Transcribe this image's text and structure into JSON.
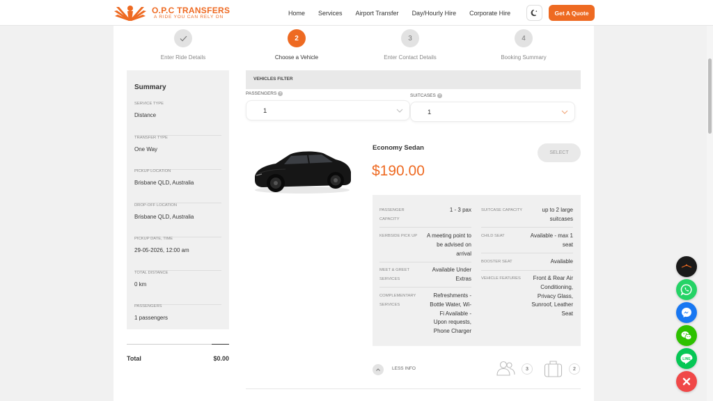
{
  "brand": {
    "name": "O.P.C TRANSFERS",
    "tagline": "A RIDE YOU CAN RELY ON",
    "accent_color": "#ee6a22"
  },
  "nav": {
    "items": [
      "Home",
      "Services",
      "Airport Transfer",
      "Day/Hourly Hire",
      "Corporate Hire"
    ],
    "theme_icon": "moon-icon",
    "cta_label": "Get A Quote"
  },
  "steps": [
    {
      "number": "",
      "icon": "check-icon",
      "label": "Enter Ride Details",
      "state": "done"
    },
    {
      "number": "2",
      "label": "Choose a Vehicle",
      "state": "active"
    },
    {
      "number": "3",
      "label": "Enter Contact Details",
      "state": "pending"
    },
    {
      "number": "4",
      "label": "Booking Summary",
      "state": "pending"
    }
  ],
  "summary": {
    "title": "Summary",
    "items": [
      {
        "key": "SERVICE TYPE",
        "value": "Distance"
      },
      {
        "key": "TRANSFER TYPE",
        "value": "One Way"
      },
      {
        "key": "PICKUP LOCATION",
        "value": "Brisbane QLD, Australia"
      },
      {
        "key": "DROP-OFF LOCATION",
        "value": "Brisbane QLD, Australia"
      },
      {
        "key": "PICKUP DATE, TIME",
        "value": "29-05-2026, 12:00 am"
      },
      {
        "key": "TOTAL DISTANCE",
        "value": "0 km"
      },
      {
        "key": "PASSENGERS",
        "value": "1 passengers"
      }
    ],
    "total_label": "Total",
    "total_value": "$0.00"
  },
  "filter": {
    "title": "VEHICLES FILTER",
    "passengers_label": "PASSENGERS",
    "passengers_value": "1",
    "suitcases_label": "SUITCASES",
    "suitcases_value": "1"
  },
  "vehicle": {
    "name": "Economy Sedan",
    "price": "$190.00",
    "select_label": "SELECT",
    "specs_left": [
      {
        "key_lines": [
          "PASSENGER",
          "CAPACITY"
        ],
        "value_lines": [
          "1 - 3 pax"
        ]
      },
      {
        "key_lines": [
          "KERBSIDE PICK UP"
        ],
        "value_lines": [
          "A meeting point to",
          "be advised on",
          "arrival"
        ]
      },
      {
        "key_lines": [
          "MEET & GREET",
          "SERVICES"
        ],
        "value_lines": [
          "Available Under",
          "Extras"
        ]
      },
      {
        "key_lines": [
          "COMPLEMENTARY",
          "SERVICES"
        ],
        "value_lines": [
          "Refreshments -",
          "Bottle Water, Wi-",
          "Fi Available -",
          "Upon requests,",
          "Phone Charger"
        ]
      }
    ],
    "specs_right": [
      {
        "key_lines": [
          "SUITCASE CAPACITY"
        ],
        "value_lines": [
          "up to 2 large",
          "suitcases"
        ]
      },
      {
        "key_lines": [
          "CHILD SEAT"
        ],
        "value_lines": [
          "Available - max 1",
          "seat"
        ]
      },
      {
        "key_lines": [
          "BOOSTER SEAT"
        ],
        "value_lines": [
          "Available"
        ]
      },
      {
        "key_lines": [
          "VEHICLE FEATURES"
        ],
        "value_lines": [
          "Front & Rear Air",
          "Conditioning,",
          "Privacy Glass,",
          "Sunroof, Leather",
          "Seat"
        ]
      }
    ],
    "less_info_label": "LESS INFO",
    "passenger_count": "3",
    "luggage_count": "2"
  },
  "floating_buttons": [
    {
      "name": "brand-chat",
      "color": "#1a1a1a"
    },
    {
      "name": "whatsapp",
      "color": "#25d366"
    },
    {
      "name": "messenger",
      "color": "#1877f2"
    },
    {
      "name": "wechat",
      "color": "#2dc100"
    },
    {
      "name": "line",
      "color": "#06c755"
    },
    {
      "name": "close",
      "color": "#f04848"
    }
  ]
}
